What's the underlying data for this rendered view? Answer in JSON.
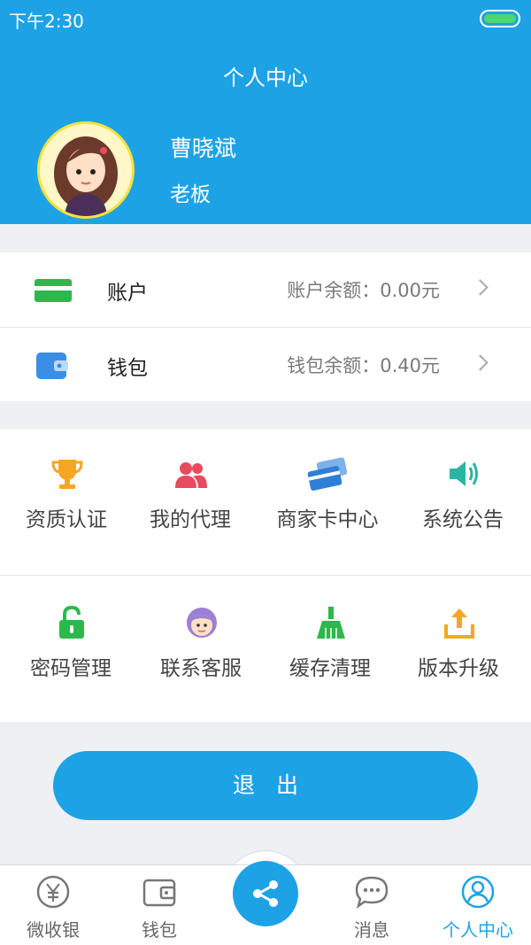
{
  "status": {
    "time": "下午2:30"
  },
  "header": {
    "title": "个人中心"
  },
  "profile": {
    "name": "曹晓斌",
    "role": "老板"
  },
  "finance": [
    {
      "label": "账户",
      "value": "账户余额：0.00元",
      "icon": "card-icon",
      "color": "#2db84d"
    },
    {
      "label": "钱包",
      "value": "钱包余额：0.40元",
      "icon": "wallet-icon",
      "color": "#3a8ee6"
    }
  ],
  "menu": [
    {
      "label": "资质认证",
      "icon": "trophy-icon",
      "color": "#f5a623"
    },
    {
      "label": "我的代理",
      "icon": "agents-icon",
      "color": "#e84a5f"
    },
    {
      "label": "商家卡中心",
      "icon": "cards-icon",
      "color": "#2f7fd8"
    },
    {
      "label": "系统公告",
      "icon": "speaker-icon",
      "color": "#2bb5a0"
    },
    {
      "label": "密码管理",
      "icon": "lock-icon",
      "color": "#2db84d"
    },
    {
      "label": "联系客服",
      "icon": "support-icon",
      "color": "#9c7fd6"
    },
    {
      "label": "缓存清理",
      "icon": "broom-icon",
      "color": "#2db84d"
    },
    {
      "label": "版本升级",
      "icon": "upload-icon",
      "color": "#f5a623"
    }
  ],
  "logout_label": "退出",
  "tabs": [
    {
      "label": "微收银",
      "icon": "yen-icon"
    },
    {
      "label": "钱包",
      "icon": "wallet-icon"
    },
    {
      "label": "",
      "icon": "share-icon"
    },
    {
      "label": "消息",
      "icon": "chat-icon"
    },
    {
      "label": "个人中心",
      "icon": "user-icon",
      "active": true
    }
  ],
  "colors": {
    "primary": "#1ea2e6",
    "background": "#eef0f3"
  }
}
